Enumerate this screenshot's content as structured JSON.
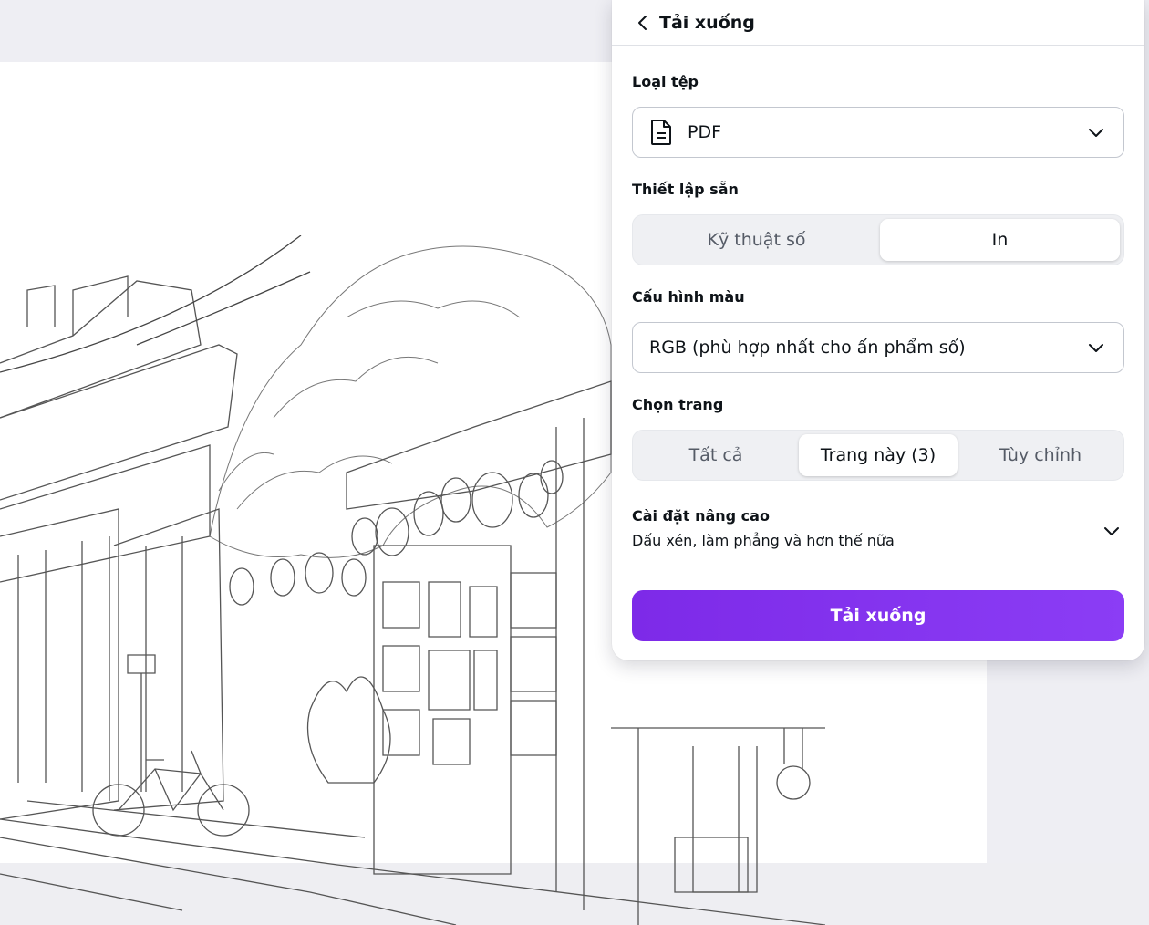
{
  "panel": {
    "title": "Tải xuống",
    "file_type": {
      "label": "Loại tệp",
      "value": "PDF",
      "icon": "document-icon"
    },
    "preset": {
      "label": "Thiết lập sẵn",
      "options": [
        "Kỹ thuật số",
        "In"
      ],
      "selected": "In"
    },
    "color_profile": {
      "label": "Cấu hình màu",
      "value": "RGB (phù hợp nhất cho ấn phẩm số)"
    },
    "pages": {
      "label": "Chọn trang",
      "options": [
        "Tất cả",
        "Trang này (3)",
        "Tùy chỉnh"
      ],
      "selected": "Trang này (3)"
    },
    "advanced": {
      "title": "Cài đặt nâng cao",
      "subtitle": "Dấu xén, làm phẳng và hơn thế nữa"
    },
    "download_button": "Tải xuống"
  },
  "colors": {
    "accent": "#7d2ae8",
    "canvas_bg": "#eeeef3"
  }
}
